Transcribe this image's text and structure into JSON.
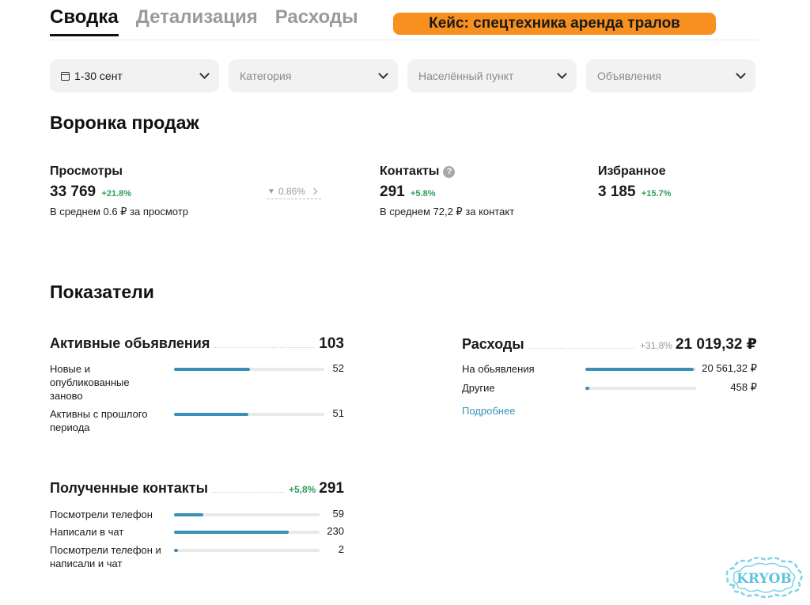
{
  "tabs": [
    {
      "label": "Сводка",
      "active": true
    },
    {
      "label": "Детализация",
      "active": false
    },
    {
      "label": "Расходы",
      "active": false
    }
  ],
  "banner": "Кейс: спецтехника аренда тралов",
  "filters": {
    "period": "1-30 сент",
    "category": "Категория",
    "city": "Населённый пункт",
    "ads": "Объявления"
  },
  "funnel": {
    "title": "Воронка продаж",
    "views": {
      "label": "Просмотры",
      "value": "33 769",
      "delta": "+21.8%",
      "sub": "В среднем 0.6 ₽ за просмотр"
    },
    "conversion": "0.86%",
    "contacts": {
      "label": "Контакты",
      "value": "291",
      "delta": "+5.8%",
      "sub": "В среднем 72,2 ₽ за контакт"
    },
    "favorites": {
      "label": "Избранное",
      "value": "3 185",
      "delta": "+15.7%"
    }
  },
  "metrics": {
    "title": "Показатели",
    "active_ads": {
      "label": "Активные обьявления",
      "total": "103",
      "rows": [
        {
          "label": "Новые и опубликованные заново",
          "value": "52",
          "fraction": 0.505
        },
        {
          "label": "Активны с прошлого периода",
          "value": "51",
          "fraction": 0.495
        }
      ]
    },
    "expenses": {
      "label": "Расходы",
      "delta": "+31,8%",
      "total": "21 019,32 ₽",
      "rows": [
        {
          "label": "На обьявления",
          "value": "20 561,32 ₽",
          "fraction": 0.978
        },
        {
          "label": "Другие",
          "value": "458 ₽",
          "fraction": 0.022
        }
      ],
      "more_link": "Подробнее"
    },
    "contacts": {
      "label": "Полученные контакты",
      "delta": "+5,8%",
      "total": "291",
      "rows": [
        {
          "label": "Посмотрели телефон",
          "value": "59",
          "fraction": 0.203
        },
        {
          "label": "Написали в чат",
          "value": "230",
          "fraction": 0.79
        },
        {
          "label": "Посмотрели телефон и написали и чат",
          "value": "2",
          "fraction": 0.007
        }
      ]
    }
  },
  "watermark": "KRYOB",
  "colors": {
    "accent": "#3b8fb6",
    "positive": "#2f9e5a",
    "banner": "#f7901e"
  }
}
